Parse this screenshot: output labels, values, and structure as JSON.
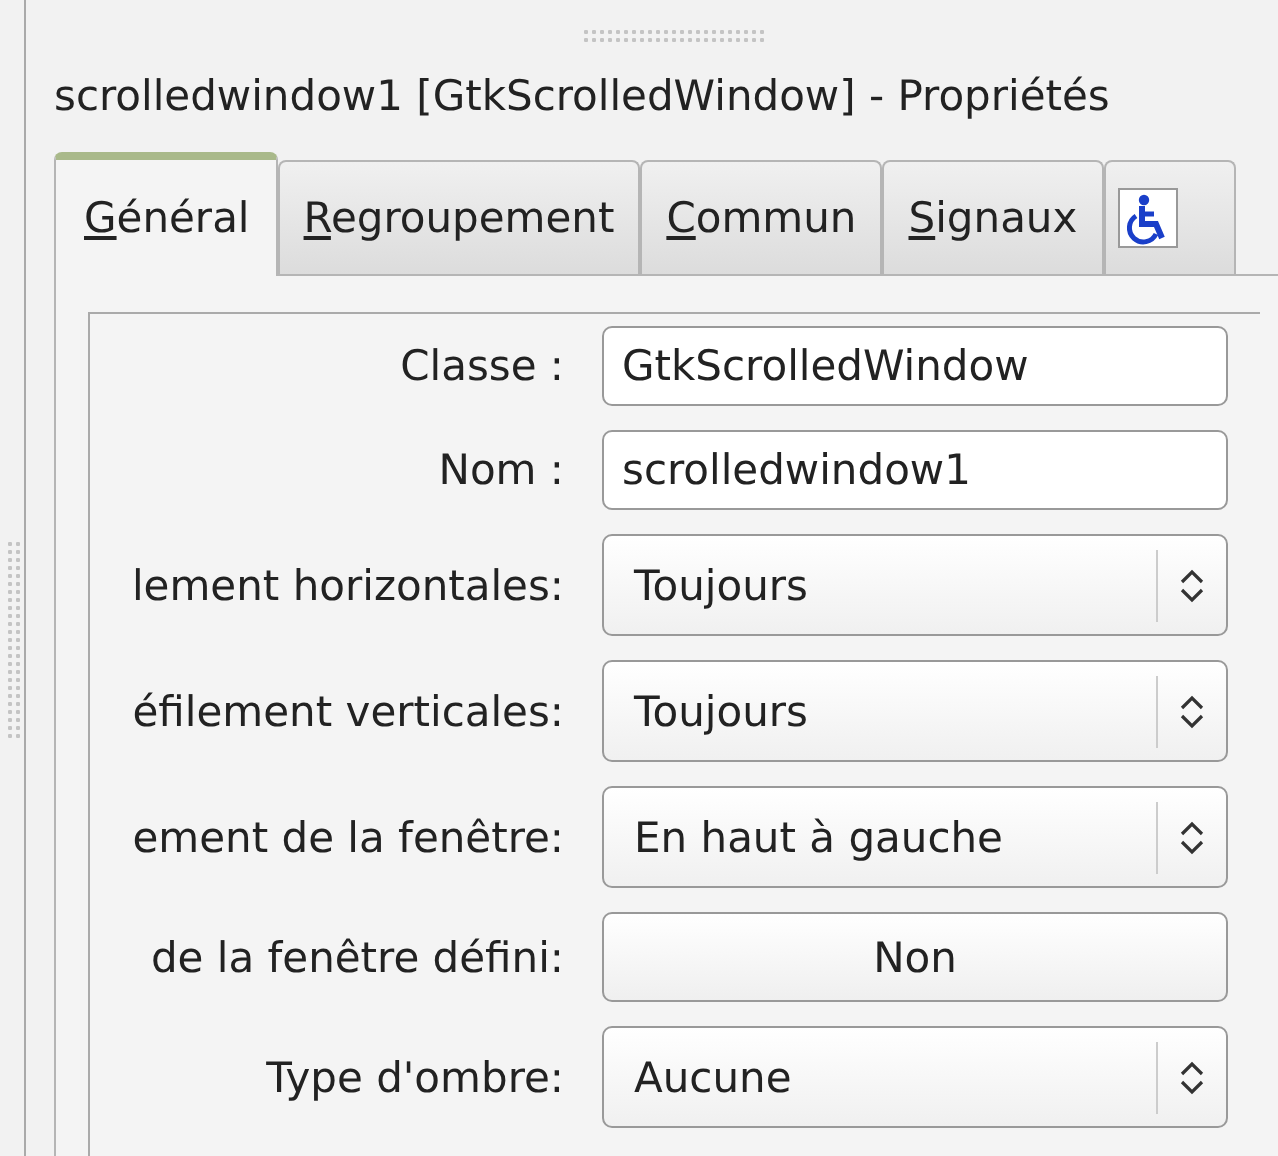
{
  "window": {
    "title": "scrolledwindow1 [GtkScrolledWindow] - Propriétés"
  },
  "tabs": [
    {
      "kind": "text",
      "label": "Général",
      "selected": true
    },
    {
      "kind": "text",
      "label": "Regroupement",
      "selected": false
    },
    {
      "kind": "text",
      "label": "Commun",
      "selected": false
    },
    {
      "kind": "text",
      "label": "Signaux",
      "selected": false
    },
    {
      "kind": "accessibility",
      "selected": false
    }
  ],
  "properties": [
    {
      "label": "Classe :",
      "kind": "entry",
      "value": "GtkScrolledWindow"
    },
    {
      "label": "Nom :",
      "kind": "entry",
      "value": "scrolledwindow1"
    },
    {
      "label": "lement horizontales:",
      "kind": "combo",
      "value": "Toujours"
    },
    {
      "label": "éfilement verticales:",
      "kind": "combo",
      "value": "Toujours"
    },
    {
      "label": "ement de la fenêtre:",
      "kind": "combo",
      "value": "En haut à gauche"
    },
    {
      "label": "de la fenêtre défini:",
      "kind": "toggle",
      "value": "Non"
    },
    {
      "label": "Type d'ombre:",
      "kind": "combo",
      "value": "Aucune"
    }
  ]
}
